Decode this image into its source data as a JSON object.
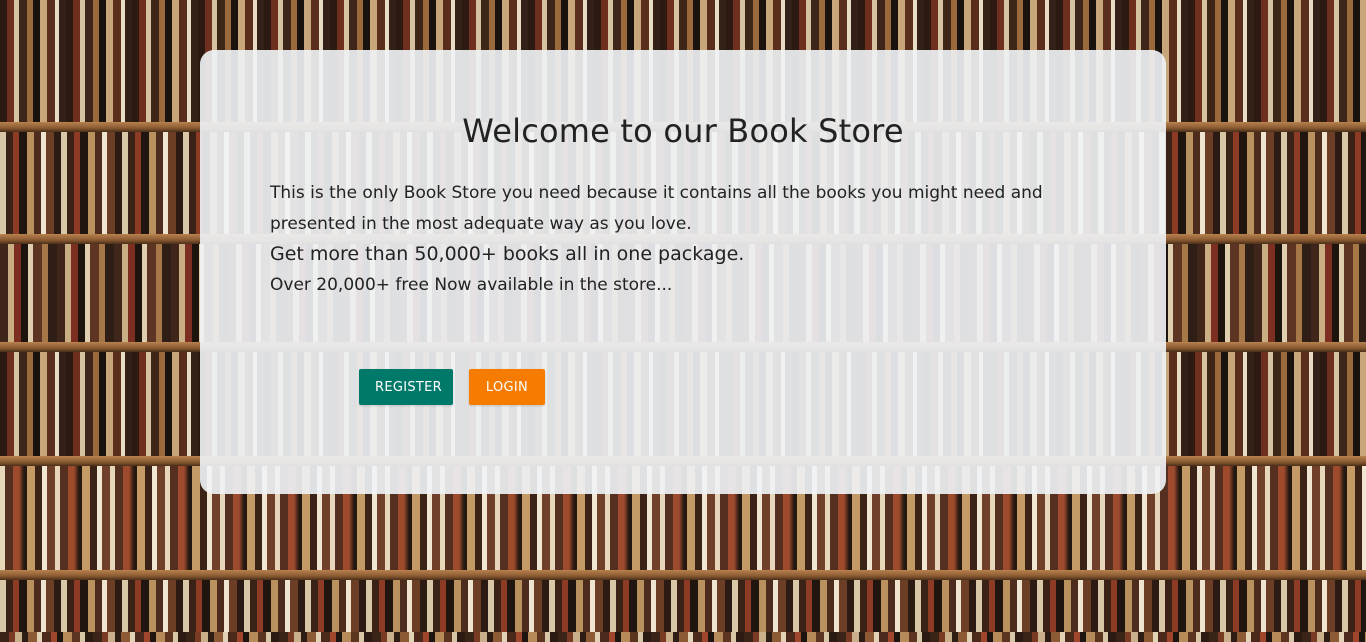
{
  "background": {
    "theme": "bookshelf",
    "colors": {
      "wood": "#8a5a32",
      "dark_spine": "#2c1a12"
    }
  },
  "hero": {
    "title": "Welcome to our Book Store",
    "intro": "This is the only Book Store you need because it contains all the books you might need and presented in the most adequate way as you love.",
    "highlight": "Get more than 50,000+ books all in one package.",
    "free_note": "Over 20,000+ free Now available in the store...",
    "buttons": {
      "register_label": "REGISTER",
      "login_label": "LOGIN"
    },
    "colors": {
      "register": "#00796b",
      "login": "#f57c00",
      "card_background": "#f0f3f6"
    }
  }
}
